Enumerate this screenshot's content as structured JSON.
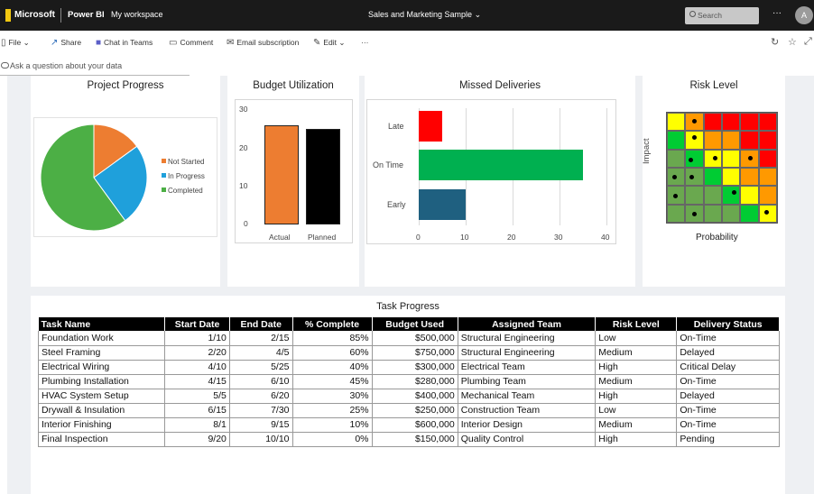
{
  "topbar": {
    "brand": "Microsoft",
    "product": "Power BI",
    "workspace": "My workspace",
    "report_title": "Sales and Marketing Sample",
    "report_chevron": "⌄",
    "search_placeholder": "Search",
    "more": "···",
    "avatar_initial": "A"
  },
  "commandbar": {
    "file": "File",
    "share": "Share",
    "chat_in_teams": "Chat in Teams",
    "comment": "Comment",
    "email_subscription": "Email subscription",
    "edit": "Edit",
    "more": "···",
    "chevron": "⌄",
    "refresh_icon": "↻",
    "favorite_icon": "☆",
    "expand_icon": "⤢"
  },
  "qa": {
    "placeholder": "Ask a question about your data"
  },
  "project_progress": {
    "title": "Project Progress",
    "colors": {
      "not_started": "#ed7d31",
      "in_progress": "#1fa0db",
      "completed": "#4caf45"
    },
    "chart_data": {
      "type": "pie",
      "categories": [
        "Not Started",
        "In Progress",
        "Completed"
      ],
      "values": [
        15,
        25,
        60
      ]
    }
  },
  "budget_utilization": {
    "title": "Budget Utilization",
    "colors": {
      "actual": "#ed7d31",
      "planned": "#000000"
    },
    "chart_data": {
      "type": "bar",
      "categories": [
        "Actual",
        "Planned"
      ],
      "values": [
        26,
        25
      ],
      "yticks": [
        "30",
        "20",
        "10",
        "0"
      ],
      "ylim": [
        0,
        30
      ]
    }
  },
  "missed_deliveries": {
    "title": "Missed Deliveries",
    "colors": {
      "late": "#ff0000",
      "on_time": "#00b050",
      "early": "#1f6080"
    },
    "chart_data": {
      "type": "bar",
      "orientation": "horizontal",
      "categories": [
        "Late",
        "On Time",
        "Early"
      ],
      "values": [
        5,
        35,
        10
      ],
      "xticks": [
        "0",
        "10",
        "20",
        "30",
        "40"
      ],
      "xlim": [
        0,
        40
      ]
    }
  },
  "risk_level": {
    "title": "Risk Level",
    "ylabel": "Impact",
    "xlabel": "Probability",
    "colors": {
      "green": "#6aa84f",
      "light_green": "#00cc33",
      "yellow": "#ffff00",
      "orange": "#ff9900",
      "red": "#ff0000"
    },
    "chart_data": {
      "type": "heatmap",
      "matrix": [
        [
          "yellow",
          "orange",
          "red",
          "red",
          "red",
          "red"
        ],
        [
          "light_green",
          "yellow",
          "orange",
          "orange",
          "red",
          "red"
        ],
        [
          "green",
          "light_green",
          "yellow",
          "yellow",
          "orange",
          "red"
        ],
        [
          "green",
          "green",
          "light_green",
          "yellow",
          "orange",
          "orange"
        ],
        [
          "green",
          "green",
          "green",
          "light_green",
          "yellow",
          "orange"
        ],
        [
          "green",
          "green",
          "green",
          "green",
          "light_green",
          "yellow"
        ]
      ],
      "points": [
        {
          "x": 2,
          "y": 6
        },
        {
          "x": 2,
          "y": 5
        },
        {
          "x": 2,
          "y": 4
        },
        {
          "x": 3,
          "y": 4
        },
        {
          "x": 5,
          "y": 4
        },
        {
          "x": 2,
          "y": 3
        },
        {
          "x": 1,
          "y": 3
        },
        {
          "x": 1,
          "y": 2
        },
        {
          "x": 4,
          "y": 2
        },
        {
          "x": 2,
          "y": 1
        },
        {
          "x": 6,
          "y": 1
        }
      ]
    }
  },
  "task_progress": {
    "title": "Task Progress",
    "columns": [
      "Task Name",
      "Start Date",
      "End Date",
      "% Complete",
      "Budget Used",
      "Assigned Team",
      "Risk Level",
      "Delivery Status"
    ],
    "rows": [
      [
        "Foundation Work",
        "1/10",
        "2/15",
        "85%",
        "$500,000",
        "Structural Engineering",
        "Low",
        "On-Time"
      ],
      [
        "Steel Framing",
        "2/20",
        "4/5",
        "60%",
        "$750,000",
        "Structural Engineering",
        "Medium",
        "Delayed"
      ],
      [
        "Electrical Wiring",
        "4/10",
        "5/25",
        "40%",
        "$300,000",
        "Electrical Team",
        "High",
        "Critical Delay"
      ],
      [
        "Plumbing Installation",
        "4/15",
        "6/10",
        "45%",
        "$280,000",
        "Plumbing Team",
        "Medium",
        "On-Time"
      ],
      [
        "HVAC System Setup",
        "5/5",
        "6/20",
        "30%",
        "$400,000",
        "Mechanical Team",
        "High",
        "Delayed"
      ],
      [
        "Drywall & Insulation",
        "6/15",
        "7/30",
        "25%",
        "$250,000",
        "Construction Team",
        "Low",
        "On-Time"
      ],
      [
        "Interior Finishing",
        "8/1",
        "9/15",
        "10%",
        "$600,000",
        "Interior Design",
        "Medium",
        "On-Time"
      ],
      [
        "Final Inspection",
        "9/20",
        "10/10",
        "0%",
        "$150,000",
        "Quality Control",
        "High",
        "Pending"
      ]
    ]
  }
}
